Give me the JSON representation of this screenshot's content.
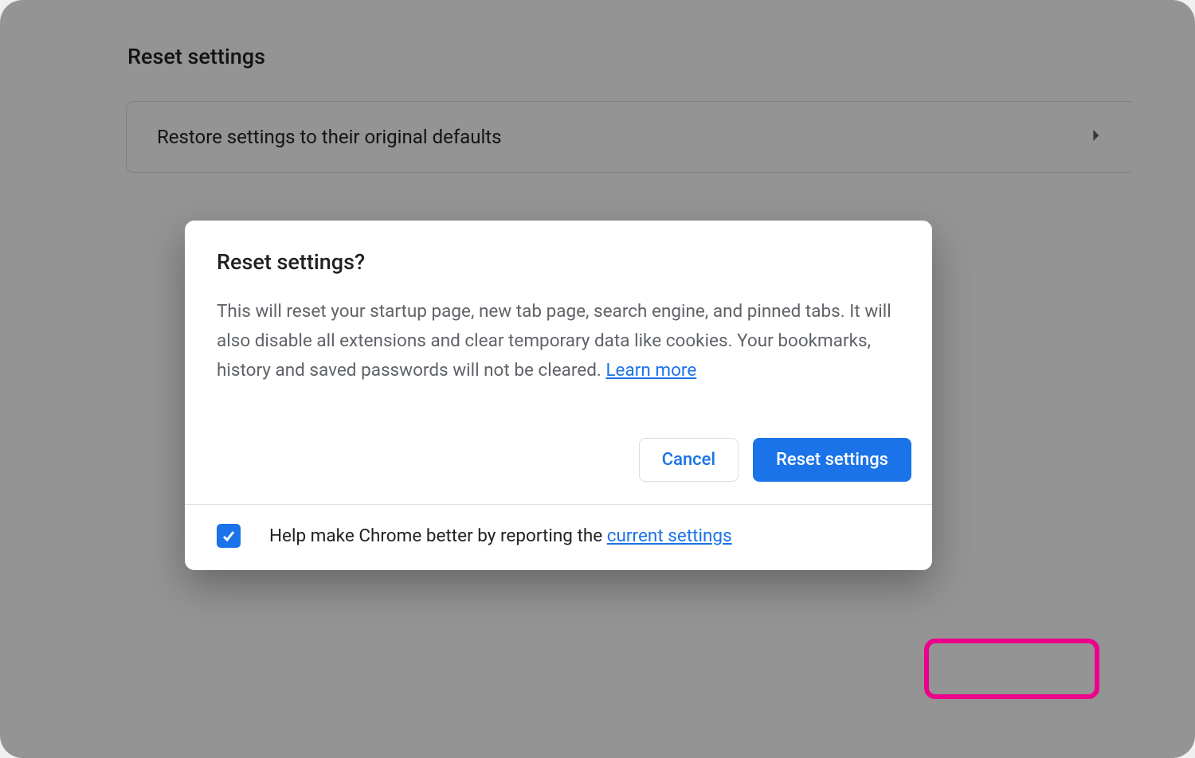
{
  "settings_page": {
    "section_title": "Reset settings",
    "restore_row_label": "Restore settings to their original defaults"
  },
  "dialog": {
    "title": "Reset settings?",
    "description_text": "This will reset your startup page, new tab page, search engine, and pinned tabs. It will also disable all extensions and clear temporary data like cookies. Your bookmarks, history and saved passwords will not be cleared. ",
    "learn_more_label": "Learn more",
    "cancel_label": "Cancel",
    "reset_label": "Reset settings",
    "footer_text_before": "Help make Chrome better by reporting the ",
    "footer_link_label": "current settings",
    "checkbox_checked": true
  },
  "colors": {
    "primary": "#1a73e8",
    "highlight_ring": "#ec008c"
  }
}
